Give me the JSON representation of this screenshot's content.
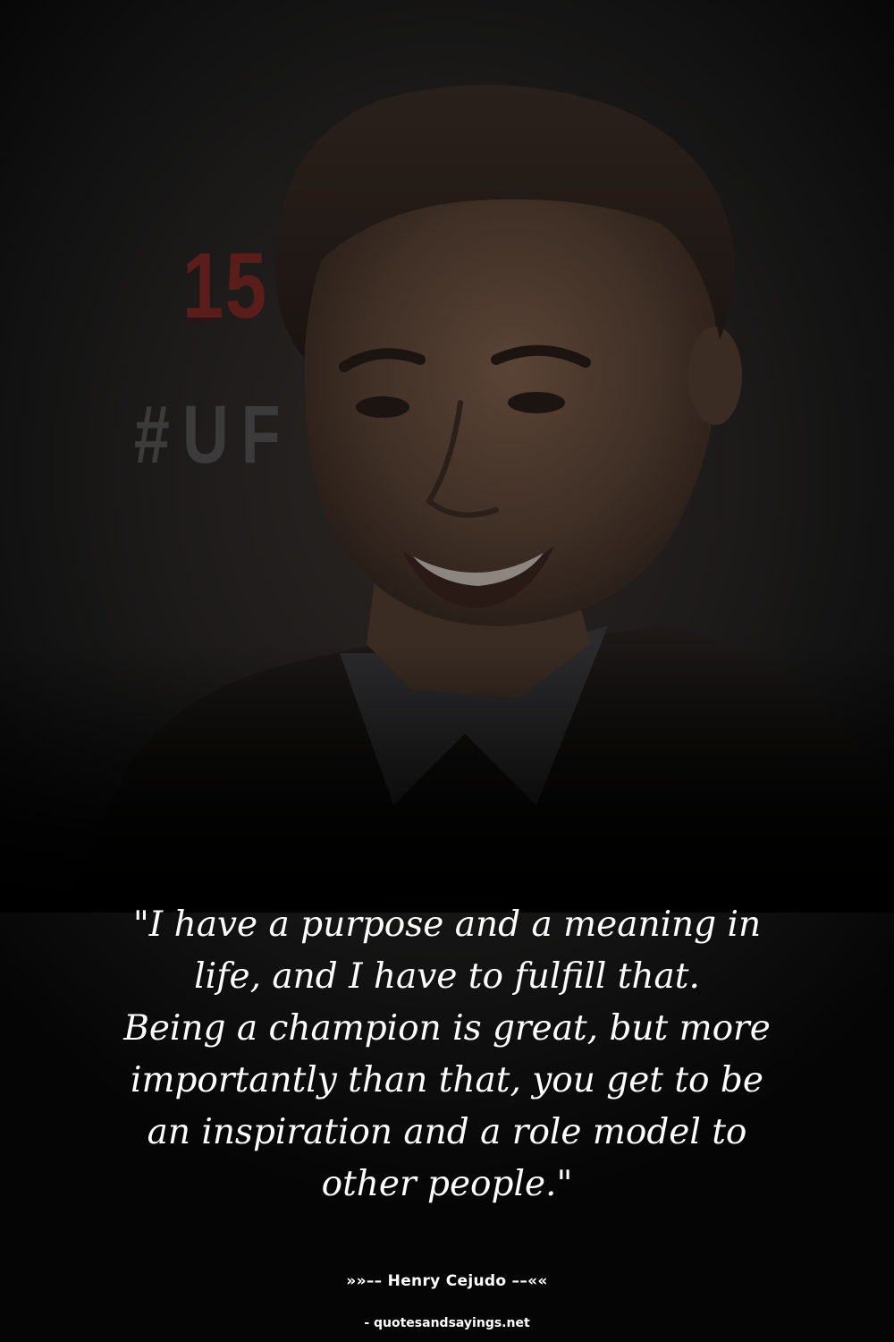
{
  "background": {
    "backdrop_text_number": "15",
    "backdrop_text_hashtag": "#UF",
    "colors": {
      "backdrop": "#1d1b1a",
      "number_red": "#5a1d1a",
      "text": "#ffffff"
    }
  },
  "quote": {
    "lines": [
      "\"I have a purpose and a meaning in",
      "life, and I have to fulfill that.",
      "Being a champion is great, but more",
      "importantly than that, you get to be",
      "an inspiration and a role model to",
      "other people.\""
    ]
  },
  "author": {
    "label": "»»–– Henry Cejudo ––««"
  },
  "source": {
    "label": "- quotesandsayings.net"
  }
}
